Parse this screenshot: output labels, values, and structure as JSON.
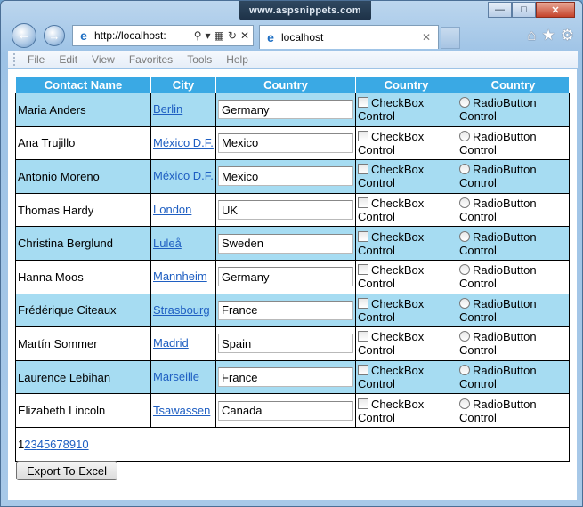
{
  "browser": {
    "banner": "www.aspsnippets.com",
    "address": "http://localhost:",
    "tab_title": "localhost",
    "menu": [
      "File",
      "Edit",
      "View",
      "Favorites",
      "Tools",
      "Help"
    ]
  },
  "grid": {
    "headers": [
      "Contact Name",
      "City",
      "Country",
      "Country",
      "Country"
    ],
    "rows": [
      {
        "name": "Maria Anders",
        "city": "Berlin",
        "country": "Germany"
      },
      {
        "name": "Ana Trujillo",
        "city": "México D.F.",
        "country": "Mexico"
      },
      {
        "name": "Antonio Moreno",
        "city": "México D.F.",
        "country": "Mexico"
      },
      {
        "name": "Thomas Hardy",
        "city": "London",
        "country": "UK"
      },
      {
        "name": "Christina Berglund",
        "city": "Luleå",
        "country": "Sweden"
      },
      {
        "name": "Hanna Moos",
        "city": "Mannheim",
        "country": "Germany"
      },
      {
        "name": "Frédérique Citeaux",
        "city": "Strasbourg",
        "country": "France"
      },
      {
        "name": "Martín Sommer",
        "city": "Madrid",
        "country": "Spain"
      },
      {
        "name": "Laurence Lebihan",
        "city": "Marseille",
        "country": "France"
      },
      {
        "name": "Elizabeth Lincoln",
        "city": "Tsawassen",
        "country": "Canada"
      }
    ],
    "checkbox_label": "CheckBox Control",
    "radio_label": "RadioButton Control",
    "pager": {
      "current": "1",
      "pages": [
        "2",
        "3",
        "4",
        "5",
        "6",
        "7",
        "8",
        "9",
        "10"
      ]
    }
  },
  "export_button": "Export To Excel",
  "colors": {
    "header": "#3aa9e4",
    "alt_row": "#a6dcf2",
    "link": "#1f5fc2"
  }
}
